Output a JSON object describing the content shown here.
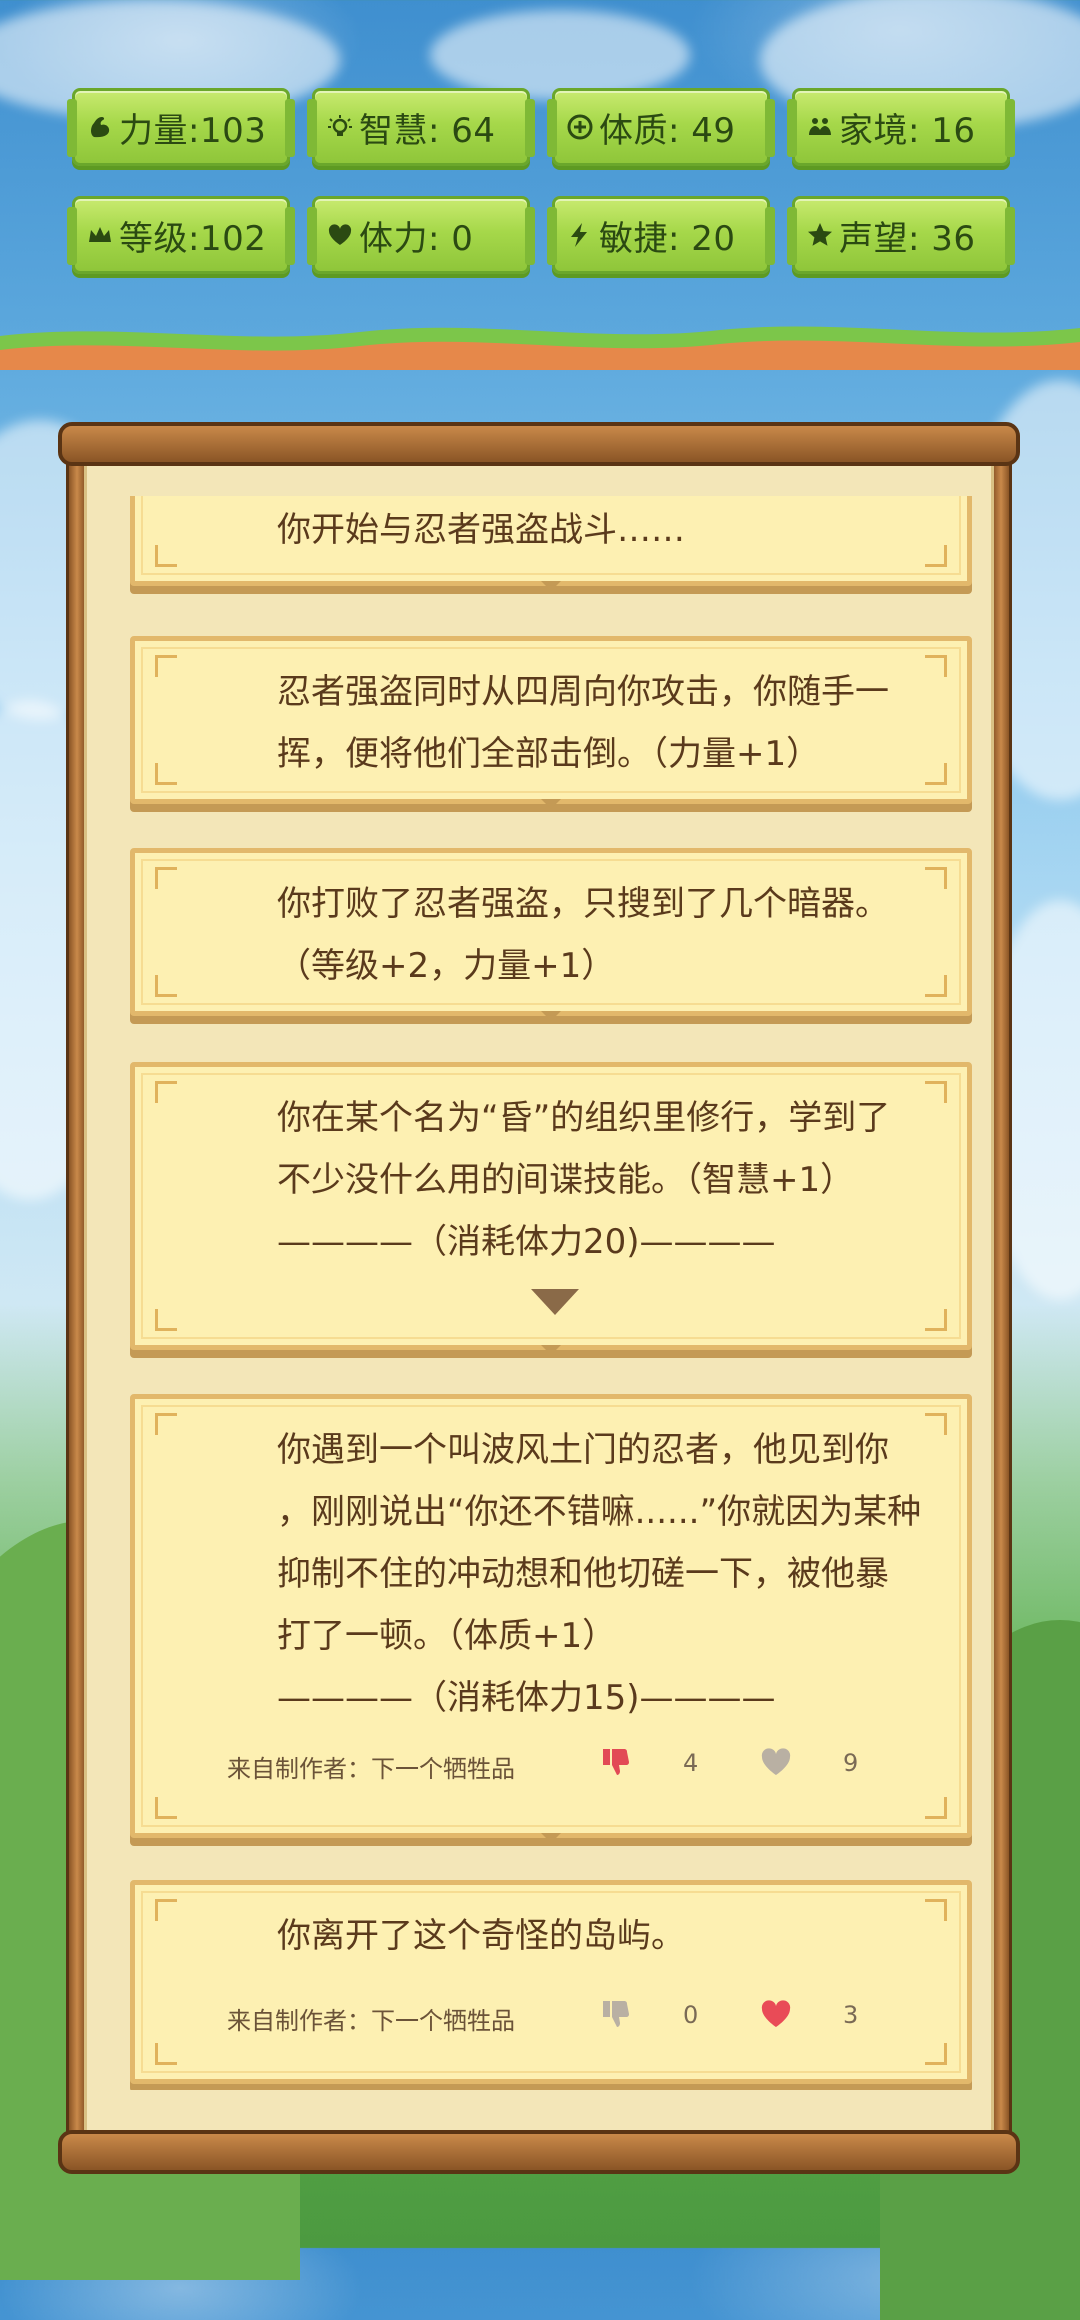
{
  "stats": [
    {
      "icon": "strength-arm-icon",
      "label": "力量:103"
    },
    {
      "icon": "bulb-icon",
      "label": "智慧: 64"
    },
    {
      "icon": "heart-cross-icon",
      "label": "体质: 49"
    },
    {
      "icon": "family-icon",
      "label": "家境: 16"
    },
    {
      "icon": "crown-icon",
      "label": "等级:102"
    },
    {
      "icon": "heart-icon",
      "label": "体力:  0"
    },
    {
      "icon": "lightning-icon",
      "label": "敏捷: 20"
    },
    {
      "icon": "star-icon",
      "label": "声望: 36"
    }
  ],
  "events": {
    "e1": {
      "text": "你开始与忍者强盗战斗……"
    },
    "e2": {
      "line1": "忍者强盗同时从四周向你攻击，你随手一",
      "line2": "挥，便将他们全部击倒。（力量+1）"
    },
    "e3": {
      "line1": "你打败了忍者强盗，只搜到了几个暗器。",
      "line2": "（等级+2，力量+1）"
    },
    "e4": {
      "line1": "你在某个名为“昏”的组织里修行，学到了",
      "line2": "不少没什么用的间谍技能。（智慧+1）",
      "line3": "————（消耗体力20)————"
    },
    "e5": {
      "line1": "你遇到一个叫波风土门的忍者，他见到你",
      "line2": "，刚刚说出“你还不错嘛......”你就因为某种",
      "line3": "抑制不住的冲动想和他切磋一下，被他暴",
      "line4": "打了一顿。（体质+1）",
      "line5": "————（消耗体力15)————",
      "author": "来自制作者：下一个牺牲品",
      "dislikes": "4",
      "likes": "9"
    },
    "e6": {
      "text": "你离开了这个奇怪的岛屿。",
      "author": "来自制作者：下一个牺牲品",
      "dislikes": "0",
      "likes": "3"
    }
  },
  "colors": {
    "like_active": "#e94b57",
    "dislike_active": "#e24a55",
    "inactive": "#b9b0a3"
  }
}
